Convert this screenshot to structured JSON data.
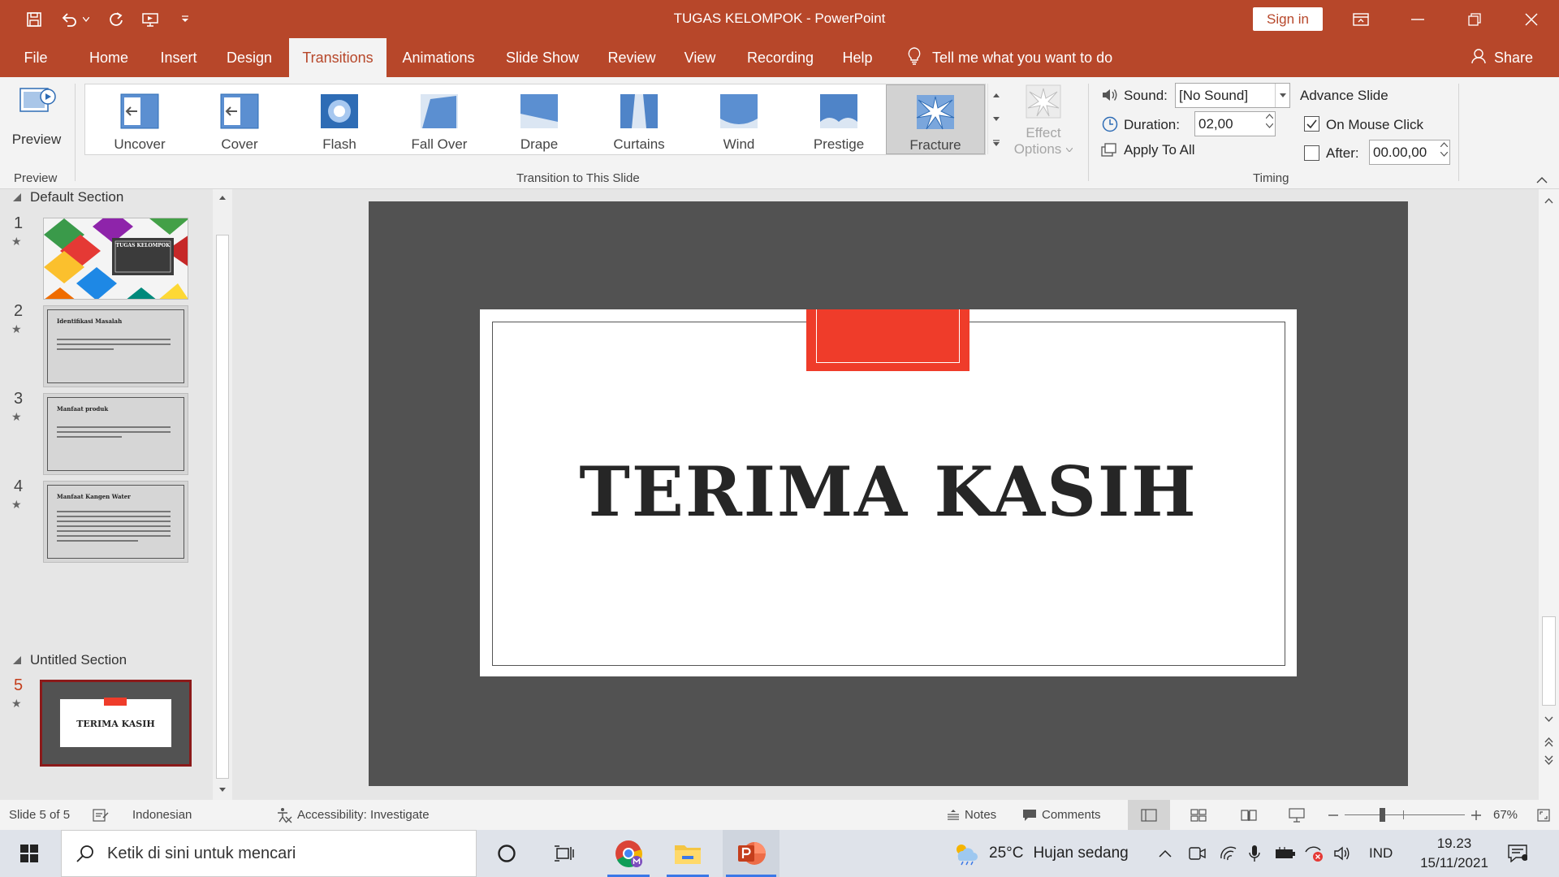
{
  "window": {
    "title": "TUGAS KELOMPOK  -  PowerPoint",
    "sign_in": "Sign in"
  },
  "tabs": [
    "File",
    "Home",
    "Insert",
    "Design",
    "Transitions",
    "Animations",
    "Slide Show",
    "Review",
    "View",
    "Recording",
    "Help"
  ],
  "active_tab": "Transitions",
  "tell_me": "Tell me what you want to do",
  "share": "Share",
  "ribbon": {
    "preview": {
      "button": "Preview",
      "group": "Preview"
    },
    "transition_group": "Transition to This Slide",
    "transitions": [
      "Uncover",
      "Cover",
      "Flash",
      "Fall Over",
      "Drape",
      "Curtains",
      "Wind",
      "Prestige",
      "Fracture"
    ],
    "selected_transition": "Fracture",
    "effect_options": [
      "Effect",
      "Options"
    ],
    "timing": {
      "group": "Timing",
      "sound_label": "Sound:",
      "sound_value": "[No Sound]",
      "duration_label": "Duration:",
      "duration_value": "02,00",
      "apply_all": "Apply To All",
      "advance_slide": "Advance Slide",
      "on_mouse_click": "On Mouse Click",
      "on_mouse_click_checked": true,
      "after_label": "After:",
      "after_value": "00.00,00",
      "after_checked": false
    }
  },
  "slides_panel": {
    "sections": [
      "Default Section",
      "Untitled Section"
    ],
    "slides": [
      {
        "number": "1",
        "title": "TUGAS KELOMPOK"
      },
      {
        "number": "2",
        "title": "Identifikasi Masalah"
      },
      {
        "number": "3",
        "title": "Manfaat produk"
      },
      {
        "number": "4",
        "title": "Manfaat Kangen Water"
      },
      {
        "number": "5",
        "title": "TERIMA KASIH"
      }
    ],
    "current_slide": 5
  },
  "slide": {
    "title": "TERIMA KASIH",
    "accent_color": "#ef3c2a",
    "background_color": "#525252"
  },
  "status": {
    "slide_info": "Slide 5 of 5",
    "language": "Indonesian",
    "accessibility": "Accessibility: Investigate",
    "notes": "Notes",
    "comments": "Comments",
    "zoom": "67%"
  },
  "taskbar": {
    "search_placeholder": "Ketik di sini untuk mencari",
    "weather_temp": "25°C",
    "weather_desc": "Hujan sedang",
    "input_lang": "IND",
    "time": "19.23",
    "date": "15/11/2021"
  },
  "colors": {
    "brand": "#b7472a",
    "ribbon_bg": "#f3f3f3"
  }
}
